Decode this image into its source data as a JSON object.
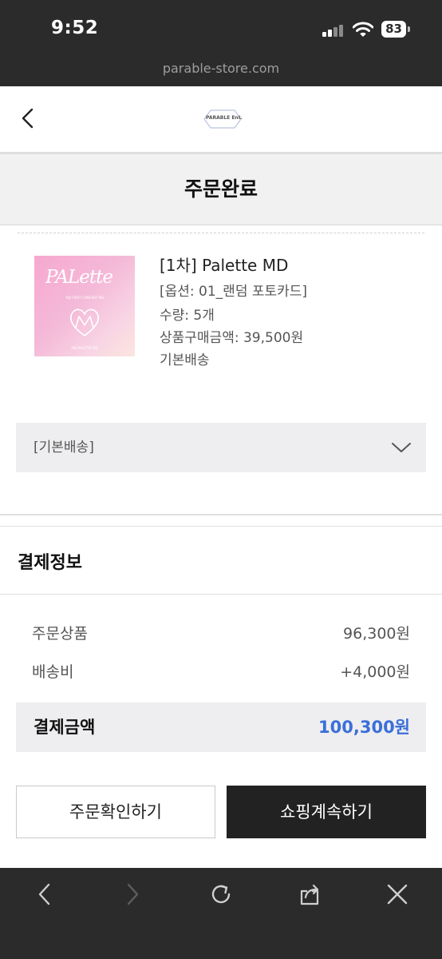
{
  "status_bar": {
    "time": "9:52",
    "battery": "83"
  },
  "browser": {
    "url": "parable-store.com"
  },
  "header": {
    "logo_text": "PARABLE Ent."
  },
  "page": {
    "title": "주문완료"
  },
  "product": {
    "thumbnail": {
      "title": "PALette",
      "subtitle": "YEJI FIRST CONCERT MD",
      "footer": "YEJI PALETTE MD"
    },
    "name": "[1차] Palette MD",
    "option": "[옵션: 01_랜덤 포토카드]",
    "quantity": "수량: 5개",
    "price": "상품구매금액: 39,500원",
    "shipping_type": "기본배송"
  },
  "shipping_select": {
    "label": "[기본배송]"
  },
  "payment": {
    "heading": "결제정보",
    "rows": [
      {
        "label": "주문상품",
        "value": "96,300원"
      },
      {
        "label": "배송비",
        "value": "+4,000원"
      }
    ],
    "total_label": "결제금액",
    "total_value": "100,300원"
  },
  "buttons": {
    "confirm_order": "주문확인하기",
    "continue_shopping": "쇼핑계속하기"
  },
  "colors": {
    "accent": "#3b6fd8",
    "dark": "#222222",
    "bar": "#2b2b2b"
  },
  "icons": [
    "back-icon",
    "forward-icon",
    "refresh-icon",
    "share-icon",
    "close-icon",
    "chevron-down-icon",
    "signal-icon",
    "wifi-icon",
    "battery-icon"
  ]
}
